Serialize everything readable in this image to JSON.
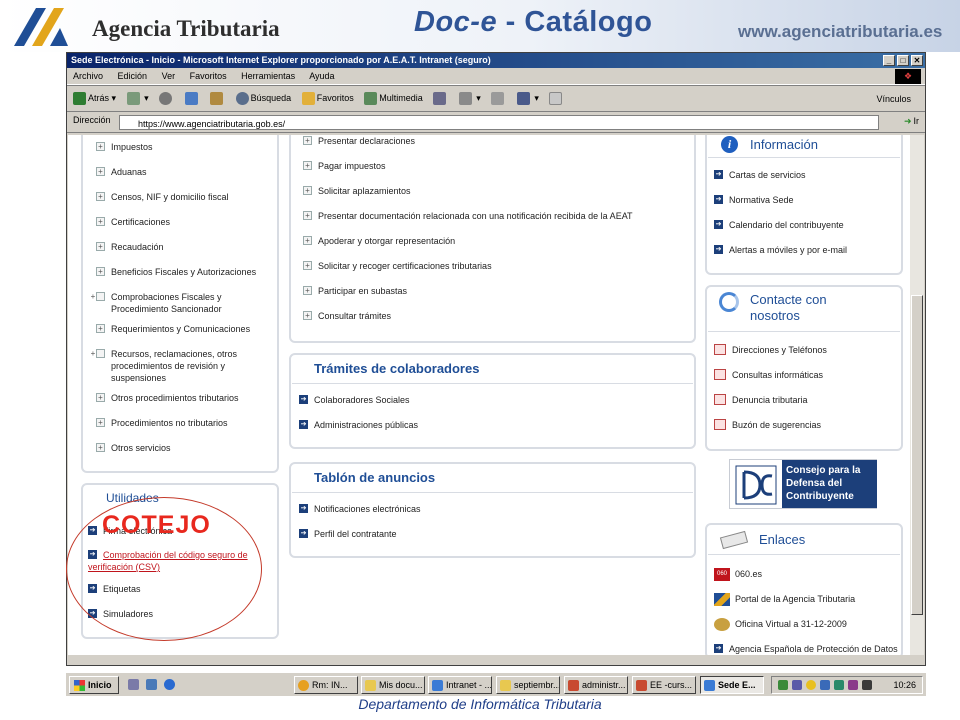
{
  "slide": {
    "agency_name": "Agencia Tributaria",
    "title_em": "Doc-e",
    "title_rest": " - Catálogo",
    "site_url": "www.agenciatributaria.es",
    "footer": "Departamento de Informática Tributaria"
  },
  "browser": {
    "window_title": "Sede Electrónica - Inicio - Microsoft Internet Explorer proporcionado por A.E.A.T. Intranet (seguro)",
    "menu": [
      "Archivo",
      "Edición",
      "Ver",
      "Favoritos",
      "Herramientas",
      "Ayuda"
    ],
    "toolbar": {
      "back": "Atrás",
      "search": "Búsqueda",
      "favorites": "Favoritos",
      "multimedia": "Multimedia",
      "links": "Vínculos"
    },
    "address": {
      "label": "Dirección",
      "url": "https://www.agenciatributaria.gob.es/",
      "go": "Ir"
    }
  },
  "left_menu": {
    "items": [
      "Impuestos",
      "Aduanas",
      "Censos, NIF y domicilio fiscal",
      "Certificaciones",
      "Recaudación",
      "Beneficios Fiscales y Autorizaciones",
      "Comprobaciones Fiscales y Procedimiento Sancionador",
      "Requerimientos y Comunicaciones",
      "Recursos, reclamaciones, otros procedimientos de revisión y suspensiones",
      "Otros procedimientos tributarios",
      "Procedimientos no tributarios",
      "Otros servicios"
    ]
  },
  "utilidades": {
    "title": "Utilidades",
    "items": [
      "Firma electrónica",
      "Comprobación del código seguro de verificación (CSV)",
      "Etiquetas",
      "Simuladores"
    ]
  },
  "center_tramites": {
    "items": [
      "Presentar declaraciones",
      "Pagar impuestos",
      "Solicitar aplazamientos",
      "Presentar documentación relacionada con una notificación recibida de la AEAT",
      "Apoderar y otorgar representación",
      "Solicitar y recoger certificaciones tributarias",
      "Participar en subastas",
      "Consultar trámites"
    ]
  },
  "colaboradores": {
    "title": "Trámites de colaboradores",
    "items": [
      "Colaboradores Sociales",
      "Administraciones públicas"
    ]
  },
  "tablon": {
    "title": "Tablón de anuncios",
    "items": [
      "Notificaciones electrónicas",
      "Perfil del contratante"
    ]
  },
  "informacion": {
    "title": "Información",
    "items": [
      "Cartas de servicios",
      "Normativa Sede",
      "Calendario del contribuyente",
      "Alertas a móviles y por e-mail"
    ]
  },
  "contacte": {
    "title_line1": "Contacte con",
    "title_line2": "nosotros",
    "items": [
      "Direcciones y Teléfonos",
      "Consultas informáticas",
      "Denuncia tributaria",
      "Buzón de sugerencias"
    ]
  },
  "consejo": {
    "line1": "Consejo para la",
    "line2": "Defensa del",
    "line3": "Contribuyente"
  },
  "enlaces": {
    "title": "Enlaces",
    "items": [
      "060.es",
      "Portal de la Agencia Tributaria",
      "Oficina Virtual a 31-12-2009",
      "Agencia Española de Protección de Datos"
    ]
  },
  "taskbar": {
    "start": "Inicio",
    "tasks": [
      "Rm: IN...",
      "Mis docu...",
      "Intranet - ...",
      "septiembr...",
      "administr...",
      "EE -curs...",
      "Sede E..."
    ],
    "clock": "10:26"
  },
  "overlay": {
    "label": "COTEJO",
    "color": "#e8281e"
  }
}
